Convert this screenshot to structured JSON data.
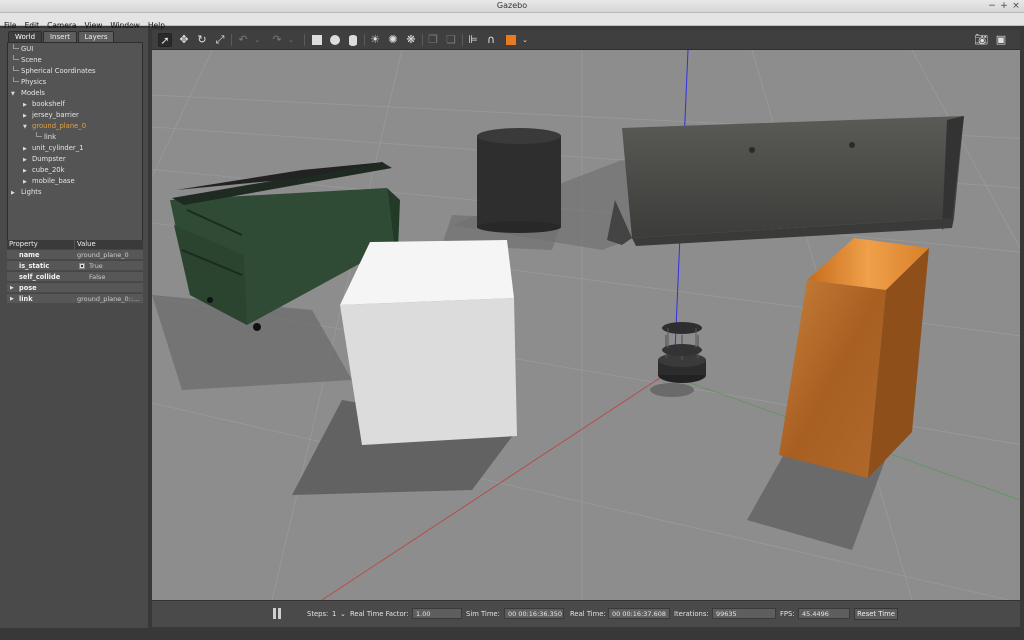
{
  "window": {
    "title": "Gazebo",
    "controls": [
      "−",
      "+",
      "×"
    ]
  },
  "menubar": {
    "items": [
      "File",
      "Edit",
      "Camera",
      "View",
      "Window",
      "Help"
    ]
  },
  "left_panel": {
    "tabs": [
      "World",
      "Insert",
      "Layers"
    ],
    "tree": {
      "gui": "GUI",
      "scene": "Scene",
      "spherical": "Spherical Coordinates",
      "physics": "Physics",
      "models": "Models",
      "model_items": [
        "bookshelf",
        "jersey_barrier",
        "ground_plane_0",
        "unit_cylinder_1",
        "Dumpster",
        "cube_20k",
        "mobile_base"
      ],
      "link": "link",
      "lights": "Lights"
    },
    "properties": {
      "header_property": "Property",
      "header_value": "Value",
      "rows": [
        {
          "key": "name",
          "value": "ground_plane_0"
        },
        {
          "key": "is_static",
          "value": "True"
        },
        {
          "key": "self_collide",
          "value": "False"
        },
        {
          "key": "pose",
          "value": ""
        },
        {
          "key": "link",
          "value": "ground_plane_0::..."
        }
      ]
    }
  },
  "toolbar": {
    "icons": [
      "select-arrow-icon",
      "translate-icon",
      "rotate-icon",
      "scale-icon",
      "undo-icon",
      "redo-icon",
      "box-icon",
      "sphere-icon",
      "cylinder-icon",
      "sun-light-icon",
      "point-light-icon",
      "spot-light-icon",
      "copy-icon",
      "paste-icon",
      "align-icon",
      "snap-icon",
      "view-angle-icon",
      "screenshot-icon",
      "record-icon"
    ]
  },
  "bottom_bar": {
    "steps_label": "Steps:",
    "steps_value": "1",
    "rtf_label": "Real Time Factor:",
    "rtf_value": "1.00",
    "sim_time_label": "Sim Time:",
    "sim_time_value": "00 00:16:36.350",
    "real_time_label": "Real Time:",
    "real_time_value": "00 00:16:37.608",
    "iterations_label": "Iterations:",
    "iterations_value": "99635",
    "fps_label": "FPS:",
    "fps_value": "45.4496",
    "reset_label": "Reset Time"
  },
  "colors": {
    "selected_tree_item": "#e8a040",
    "ground": "#8d8d8d",
    "panel": "#4a4a4a",
    "x_axis": "#c04040",
    "y_axis": "#3f9f3f",
    "z_axis": "#3030e0"
  }
}
